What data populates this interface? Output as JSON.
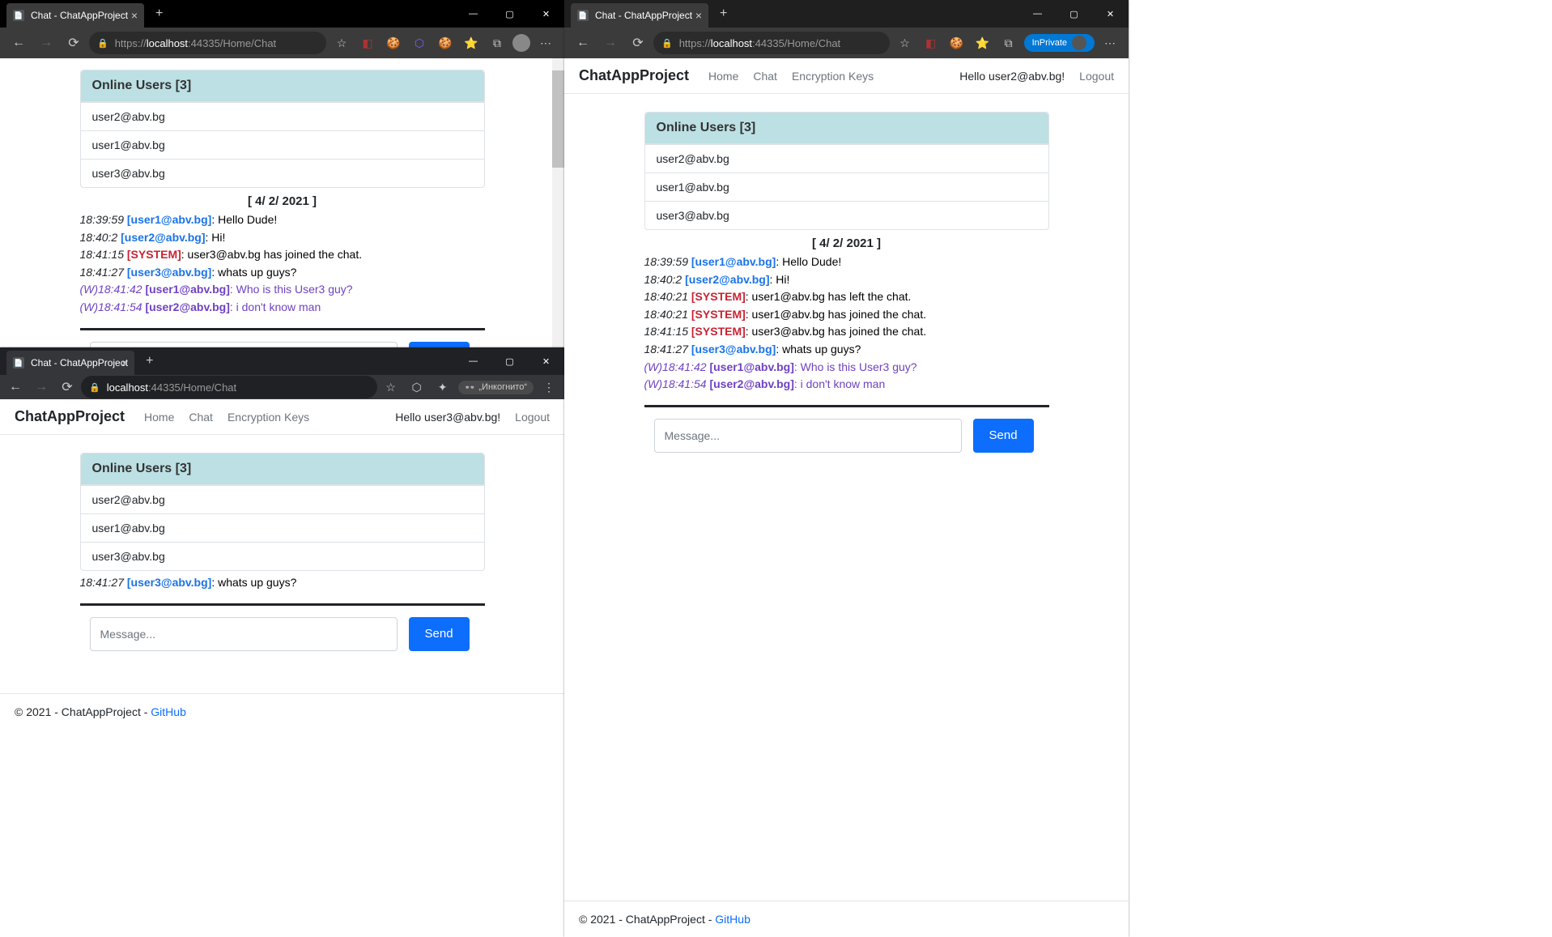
{
  "shared": {
    "tab_title": "Chat - ChatAppProject",
    "url_scheme": "https://",
    "url_host": "localhost",
    "url_port_path": ":44335/Home/Chat",
    "url_chrome_host": "localhost",
    "url_chrome_rest": ":44335/Home/Chat",
    "brand": "ChatAppProject",
    "nav_home": "Home",
    "nav_chat": "Chat",
    "nav_enc": "Encryption Keys",
    "logout": "Logout",
    "online_header_prefix": "Online Users [",
    "online_count": "3",
    "online_header_suffix": "]",
    "users": [
      "user2@abv.bg",
      "user1@abv.bg",
      "user3@abv.bg"
    ],
    "date_sep": "[ 4/ 2/ 2021 ]",
    "msg_placeholder": "Message...",
    "send_label": "Send",
    "footer_prefix": "© 2021 - ChatAppProject - ",
    "footer_link": "GitHub",
    "inprivate": "InPrivate",
    "incognito": "„Инкогнито“"
  },
  "win1": {
    "messages": [
      {
        "type": "n",
        "ts": "18:39:59",
        "user": "[user1@abv.bg]",
        "body": ": Hello Dude!"
      },
      {
        "type": "n",
        "ts": "18:40:2",
        "user": "[user2@abv.bg]",
        "body": ": Hi!"
      },
      {
        "type": "s",
        "ts": "18:41:15",
        "user": "[SYSTEM]",
        "body": ": user3@abv.bg has joined the chat."
      },
      {
        "type": "n",
        "ts": "18:41:27",
        "user": "[user3@abv.bg]",
        "body": ": whats up guys?"
      },
      {
        "type": "w",
        "ts": "(W)18:41:42",
        "user": "[user1@abv.bg]",
        "body": ": Who is this User3 guy?"
      },
      {
        "type": "w",
        "ts": "(W)18:41:54",
        "user": "[user2@abv.bg]",
        "body": ": i don't know man"
      }
    ]
  },
  "win2": {
    "hello": "Hello user3@abv.bg!",
    "messages": [
      {
        "type": "n",
        "ts": "18:41:27",
        "user": "[user3@abv.bg]",
        "body": ": whats up guys?"
      }
    ]
  },
  "win3": {
    "hello": "Hello user2@abv.bg!",
    "messages": [
      {
        "type": "n",
        "ts": "18:39:59",
        "user": "[user1@abv.bg]",
        "body": ": Hello Dude!"
      },
      {
        "type": "n",
        "ts": "18:40:2",
        "user": "[user2@abv.bg]",
        "body": ": Hi!"
      },
      {
        "type": "s",
        "ts": "18:40:21",
        "user": "[SYSTEM]",
        "body": ": user1@abv.bg has left the chat."
      },
      {
        "type": "s",
        "ts": "18:40:21",
        "user": "[SYSTEM]",
        "body": ": user1@abv.bg has joined the chat."
      },
      {
        "type": "s",
        "ts": "18:41:15",
        "user": "[SYSTEM]",
        "body": ": user3@abv.bg has joined the chat."
      },
      {
        "type": "n",
        "ts": "18:41:27",
        "user": "[user3@abv.bg]",
        "body": ": whats up guys?"
      },
      {
        "type": "w",
        "ts": "(W)18:41:42",
        "user": "[user1@abv.bg]",
        "body": ": Who is this User3 guy?"
      },
      {
        "type": "w",
        "ts": "(W)18:41:54",
        "user": "[user2@abv.bg]",
        "body": ": i don't know man"
      }
    ]
  }
}
